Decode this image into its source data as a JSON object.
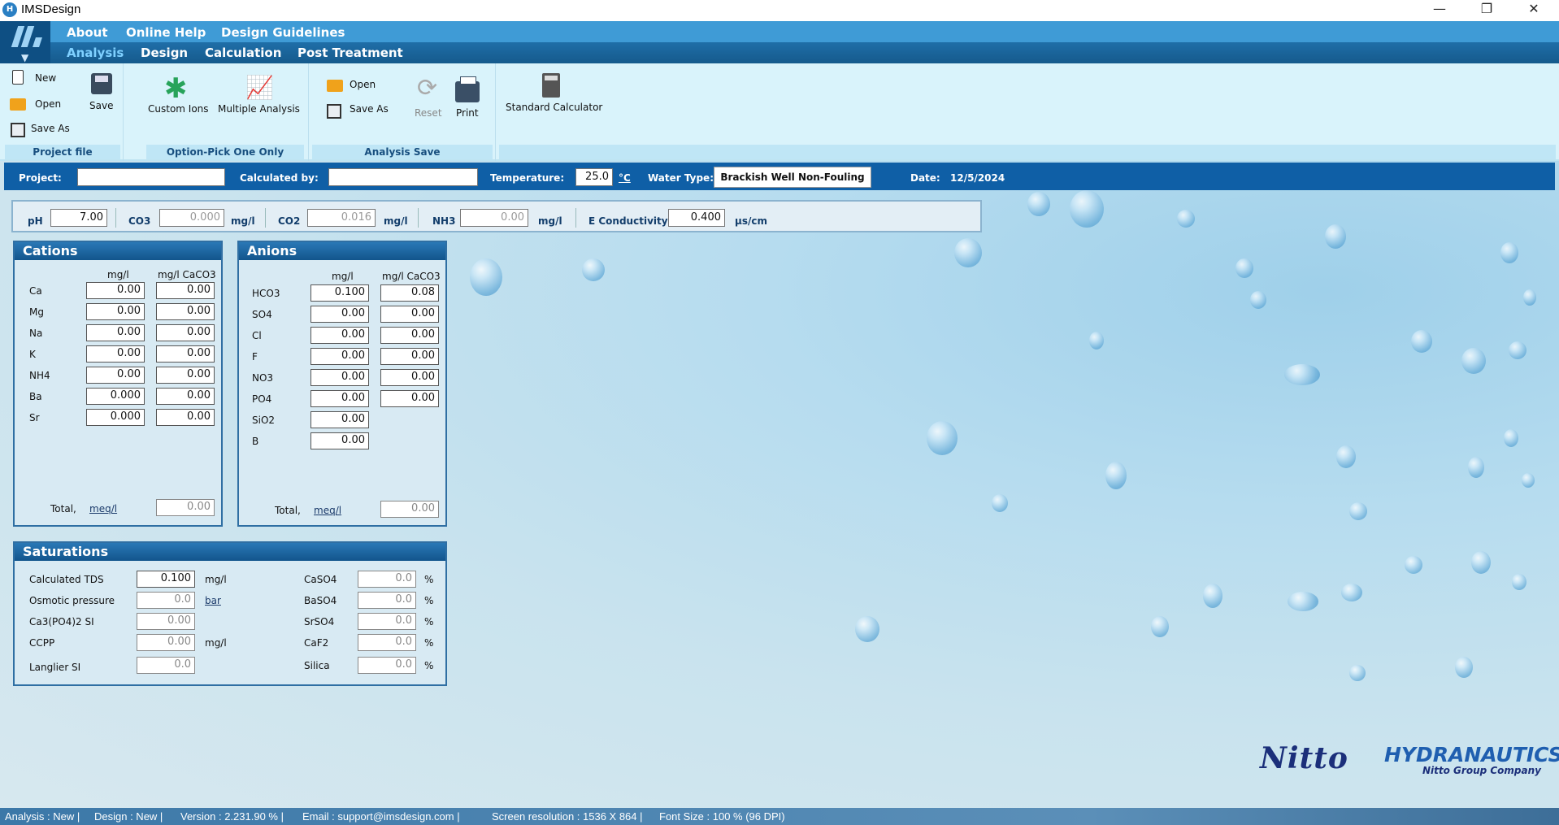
{
  "window": {
    "title": "IMSDesign",
    "minimize": "—",
    "maximize": "❐",
    "close": "✕",
    "icon_letter": "H"
  },
  "menu_top": [
    "About",
    "Online Help",
    "Design Guidelines"
  ],
  "menu_sub": [
    "Analysis",
    "Design",
    "Calculation",
    "Post Treatment"
  ],
  "ribbon": {
    "project_file": {
      "new": "New",
      "open": "Open",
      "save_as": "Save As",
      "save": "Save",
      "label": "Project file"
    },
    "option": {
      "custom_ions": "Custom Ions",
      "multiple_analysis": "Multiple Analysis",
      "label": "Option-Pick One Only"
    },
    "analysis_save": {
      "open": "Open",
      "save_as": "Save As",
      "reset": "Reset",
      "print": "Print",
      "label": "Analysis Save"
    },
    "calculator": {
      "label": "Standard Calculator"
    }
  },
  "project": {
    "project_label": "Project:",
    "project_value": "",
    "calc_by_label": "Calculated by:",
    "calc_by_value": "",
    "temp_label": "Temperature:",
    "temp_value": "25.0",
    "temp_unit": "°C",
    "water_type_label": "Water Type:",
    "water_type_value": "Brackish Well Non-Fouling",
    "date_label": "Date:",
    "date_value": "12/5/2024"
  },
  "water": {
    "ph_label": "pH",
    "ph": "7.00",
    "co3_label": "CO3",
    "co3": "0.000",
    "co3_unit": "mg/l",
    "co2_label": "CO2",
    "co2": "0.016",
    "co2_unit": "mg/l",
    "nh3_label": "NH3",
    "nh3": "0.00",
    "nh3_unit": "mg/l",
    "ec_label": "E Conductivity",
    "ec": "0.400",
    "ec_unit": "µs/cm"
  },
  "cations": {
    "title": "Cations",
    "col1": "mg/l",
    "col2": "mg/l CaCO3",
    "rows": [
      {
        "ion": "Ca",
        "mgl": "0.00",
        "caco3": "0.00"
      },
      {
        "ion": "Mg",
        "mgl": "0.00",
        "caco3": "0.00"
      },
      {
        "ion": "Na",
        "mgl": "0.00",
        "caco3": "0.00"
      },
      {
        "ion": "K",
        "mgl": "0.00",
        "caco3": "0.00"
      },
      {
        "ion": "NH4",
        "mgl": "0.00",
        "caco3": "0.00"
      },
      {
        "ion": "Ba",
        "mgl": "0.000",
        "caco3": "0.00"
      },
      {
        "ion": "Sr",
        "mgl": "0.000",
        "caco3": "0.00"
      }
    ],
    "total_label": "Total,",
    "total_unit": "meq/l",
    "total": "0.00"
  },
  "anions": {
    "title": "Anions",
    "col1": "mg/l",
    "col2": "mg/l CaCO3",
    "rows": [
      {
        "ion": "HCO3",
        "mgl": "0.100",
        "caco3": "0.08"
      },
      {
        "ion": "SO4",
        "mgl": "0.00",
        "caco3": "0.00"
      },
      {
        "ion": "Cl",
        "mgl": "0.00",
        "caco3": "0.00"
      },
      {
        "ion": "F",
        "mgl": "0.00",
        "caco3": "0.00"
      },
      {
        "ion": "NO3",
        "mgl": "0.00",
        "caco3": "0.00"
      },
      {
        "ion": "PO4",
        "mgl": "0.00",
        "caco3": "0.00"
      },
      {
        "ion": "SiO2",
        "mgl": "0.00"
      },
      {
        "ion": "B",
        "mgl": "0.00"
      }
    ],
    "total_label": "Total,",
    "total_unit": "meq/l",
    "total": "0.00"
  },
  "saturations": {
    "title": "Saturations",
    "left": [
      {
        "label": "Calculated TDS",
        "value": "0.100",
        "unit": "mg/l"
      },
      {
        "label": "Osmotic pressure",
        "value": "0.0",
        "unit": "bar"
      },
      {
        "label": "Ca3(PO4)2 SI",
        "value": "0.00",
        "unit": ""
      },
      {
        "label": "CCPP",
        "value": "0.00",
        "unit": "mg/l"
      },
      {
        "label": "Langlier SI",
        "value": "0.0",
        "unit": ""
      }
    ],
    "right": [
      {
        "label": "CaSO4",
        "value": "0.0",
        "unit": "%"
      },
      {
        "label": "BaSO4",
        "value": "0.0",
        "unit": "%"
      },
      {
        "label": "SrSO4",
        "value": "0.0",
        "unit": "%"
      },
      {
        "label": "CaF2",
        "value": "0.0",
        "unit": "%"
      },
      {
        "label": "Silica",
        "value": "0.0",
        "unit": "%"
      }
    ]
  },
  "brand": {
    "nitto": "Nitto",
    "hydranautics": "HYDRANAUTICS",
    "sub": "Nitto Group Company"
  },
  "status": {
    "analysis": "Analysis : New |",
    "design": "Design : New |",
    "version": "Version : 2.231.90 % |",
    "email": "Email : support@imsdesign.com |",
    "resolution": "Screen resolution : 1536 X 864 |",
    "font": "Font Size : 100 % (96 DPI)"
  }
}
